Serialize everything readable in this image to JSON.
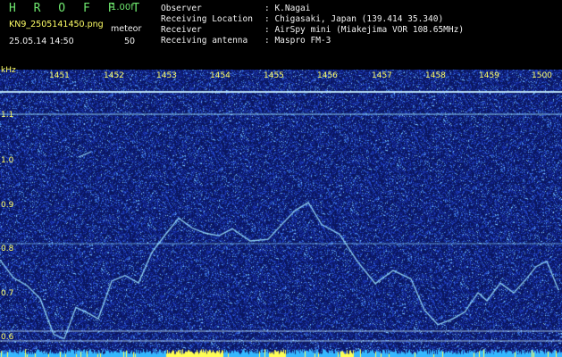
{
  "header": {
    "app_title": "H R O F F T",
    "app_version": "1.00f",
    "file_name": "KN9_2505141450.png",
    "mode_label": "meteor",
    "timestamp": "25.05.14 14:50",
    "mode_value": "50",
    "info": [
      {
        "key": "Observer",
        "value": ": K.Nagai"
      },
      {
        "key": "Receiving Location",
        "value": ": Chigasaki, Japan (139.414 35.340)"
      },
      {
        "key": "Receiver",
        "value": ": AirSpy mini (Miakejima VOR 108.65MHz)"
      },
      {
        "key": "Receiving antenna",
        "value": ": Maspro FM-3"
      }
    ]
  },
  "x_axis": {
    "ticks": [
      "1451",
      "1452",
      "1453",
      "1454",
      "1455",
      "1456",
      "1457",
      "1458",
      "1459",
      "1500"
    ]
  },
  "y_axis": {
    "unit": "kHz",
    "ticks": [
      "1.1",
      "1.0",
      "0.9",
      "0.8",
      "0.7",
      "0.6"
    ]
  },
  "colors": {
    "header_green": "#6fe86f",
    "header_white": "#f2f2f2",
    "axis_label": "#ffff66",
    "background": "#0a1a66",
    "signal": "#9fe6ff"
  }
}
